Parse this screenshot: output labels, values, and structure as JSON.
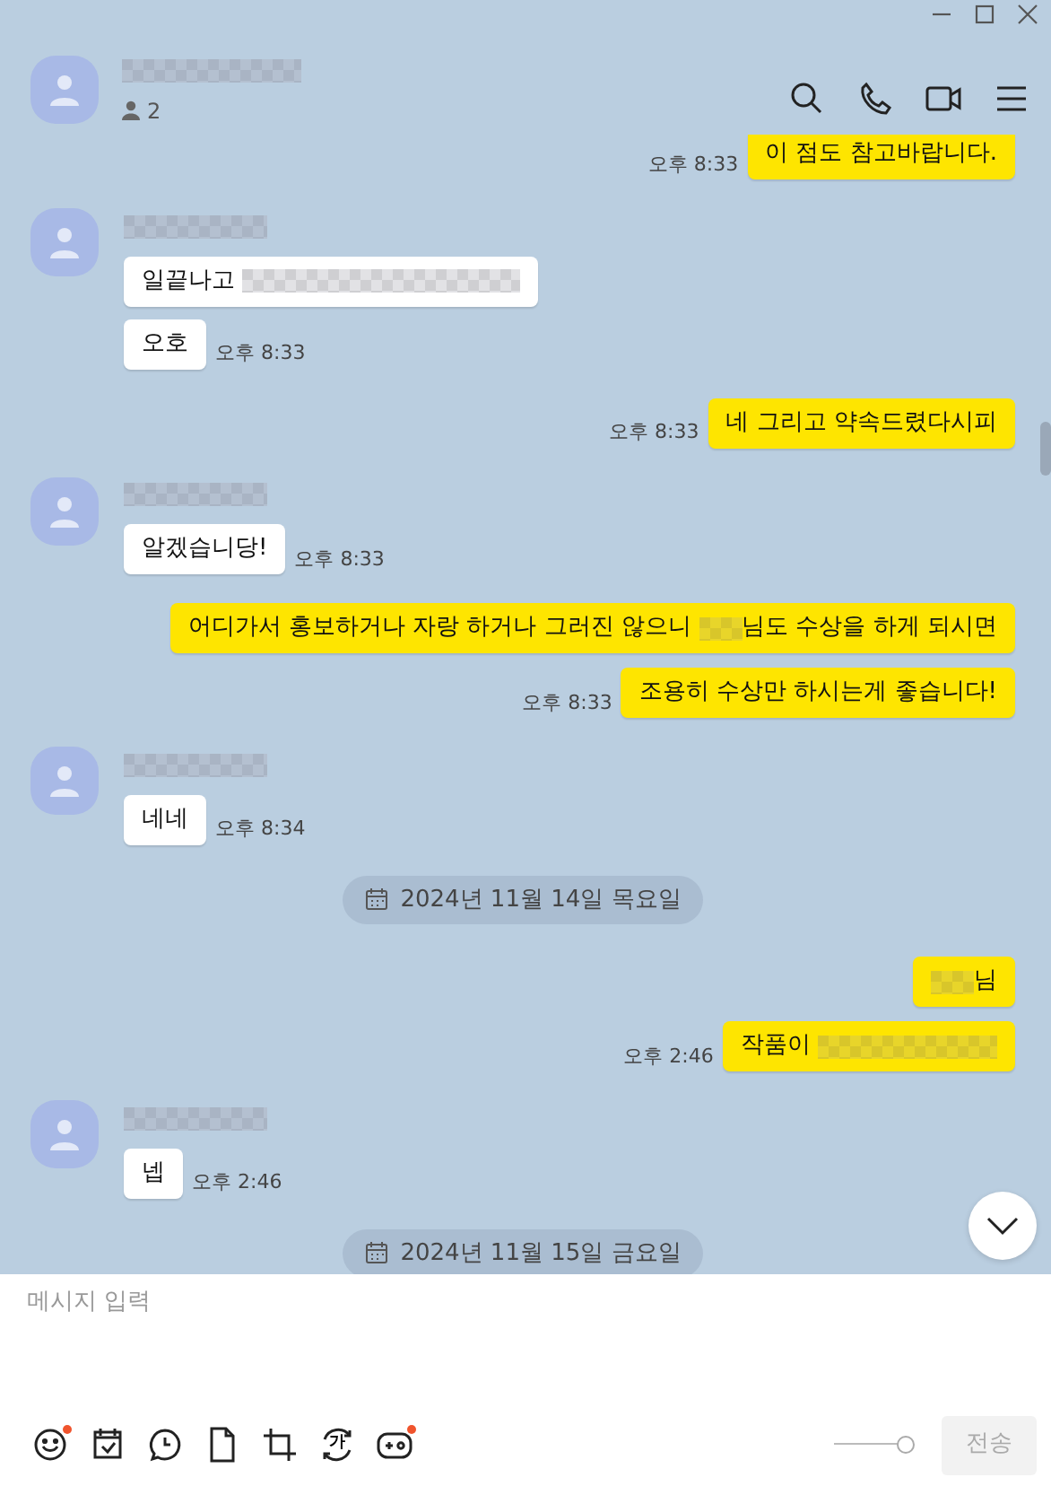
{
  "window": {
    "controls": [
      {
        "kind": "minimize"
      },
      {
        "kind": "maximize"
      },
      {
        "kind": "close"
      }
    ]
  },
  "header": {
    "title": [
      {
        "kind": "blurwide"
      }
    ],
    "members": "2",
    "actions": [
      {
        "kind": "search"
      },
      {
        "kind": "call"
      },
      {
        "kind": "video"
      },
      {
        "kind": "menu"
      }
    ]
  },
  "chat": [
    {
      "kind": "sent",
      "messages": [
        {
          "parts": [
            {
              "kind": "text",
              "text": "이 점도 참고바랍니다."
            }
          ],
          "time": "오후 8:33"
        }
      ]
    },
    {
      "kind": "received",
      "sender": [
        {
          "kind": "blurname"
        }
      ],
      "messages": [
        {
          "parts": [
            {
              "kind": "text",
              "text": "일끝나고 "
            },
            {
              "kind": "blurxwide"
            }
          ]
        },
        {
          "parts": [
            {
              "kind": "text",
              "text": "오호"
            }
          ],
          "time": "오후 8:33"
        }
      ]
    },
    {
      "kind": "sent",
      "messages": [
        {
          "parts": [
            {
              "kind": "text",
              "text": "네 그리고 약속드렸다시피"
            }
          ],
          "time": "오후 8:33"
        }
      ]
    },
    {
      "kind": "received",
      "sender": [
        {
          "kind": "blurname"
        }
      ],
      "messages": [
        {
          "parts": [
            {
              "kind": "text",
              "text": "알겠습니당!"
            }
          ],
          "time": "오후 8:33"
        }
      ]
    },
    {
      "kind": "sent",
      "messages": [
        {
          "parts": [
            {
              "kind": "text",
              "text": "어디가서 홍보하거나 자랑 하거나 그러진 않으니 "
            },
            {
              "kind": "blur"
            },
            {
              "kind": "text",
              "text": "님도 수상을 하게 되시면"
            }
          ]
        },
        {
          "parts": [
            {
              "kind": "text",
              "text": "조용히 수상만 하시는게 좋습니다!"
            }
          ],
          "time": "오후 8:33"
        }
      ]
    },
    {
      "kind": "received",
      "sender": [
        {
          "kind": "blurname"
        }
      ],
      "messages": [
        {
          "parts": [
            {
              "kind": "text",
              "text": "네네"
            }
          ],
          "time": "오후 8:34"
        }
      ]
    },
    {
      "kind": "date",
      "text": "2024년 11월 14일 목요일"
    },
    {
      "kind": "sent",
      "messages": [
        {
          "parts": [
            {
              "kind": "blur"
            },
            {
              "kind": "text",
              "text": "님"
            }
          ]
        },
        {
          "parts": [
            {
              "kind": "text",
              "text": "작품이 "
            },
            {
              "kind": "blurwide"
            }
          ],
          "time": "오후 2:46"
        }
      ]
    },
    {
      "kind": "received",
      "sender": [
        {
          "kind": "blurname"
        }
      ],
      "messages": [
        {
          "parts": [
            {
              "kind": "text",
              "text": "넵"
            }
          ],
          "time": "오후 2:46"
        }
      ]
    },
    {
      "kind": "date",
      "text": "2024년 11월 15일 금요일"
    }
  ],
  "composer": {
    "placeholder": "메시지 입력",
    "tools": [
      {
        "kind": "emoticon",
        "badge": true
      },
      {
        "kind": "calendar",
        "badge": false
      },
      {
        "kind": "clock",
        "badge": false
      },
      {
        "kind": "file",
        "badge": false
      },
      {
        "kind": "crop",
        "badge": false
      },
      {
        "kind": "translate",
        "label": "가",
        "badge": false
      },
      {
        "kind": "game",
        "badge": true
      }
    ],
    "slider": {
      "level": 0.88
    },
    "send": {
      "label": "전송",
      "disabled": true
    }
  }
}
